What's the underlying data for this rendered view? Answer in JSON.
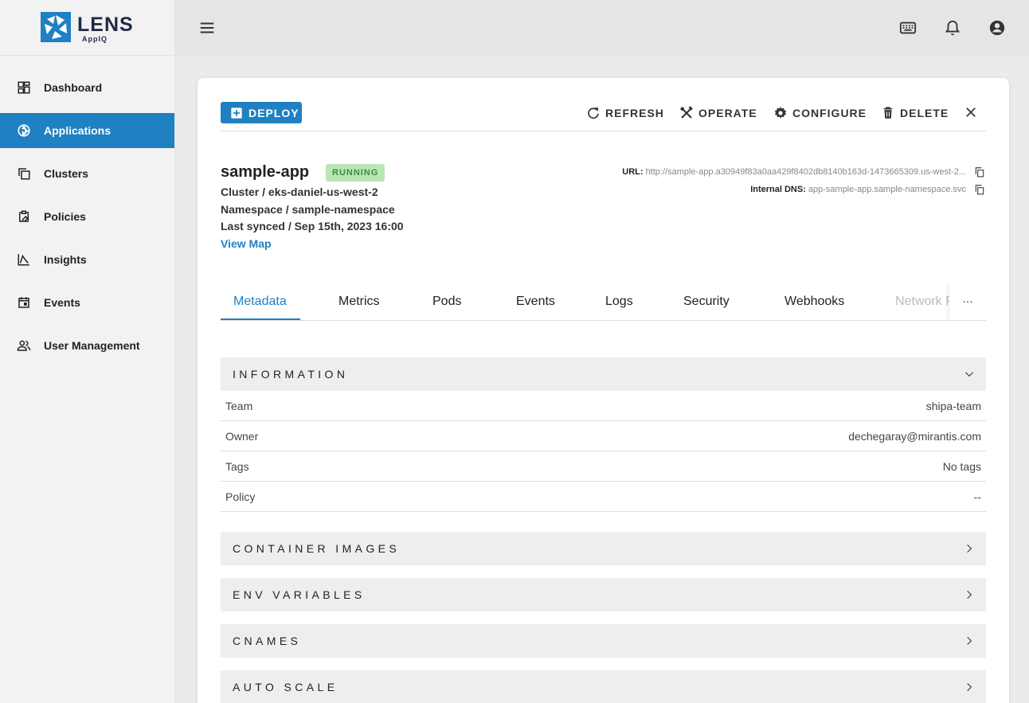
{
  "brand": {
    "name": "LENS",
    "sub": "AppIQ"
  },
  "sidebar": {
    "items": [
      {
        "label": "Dashboard",
        "icon": "dashboard-icon"
      },
      {
        "label": "Applications",
        "icon": "applications-icon",
        "active": true
      },
      {
        "label": "Clusters",
        "icon": "clusters-icon"
      },
      {
        "label": "Policies",
        "icon": "policies-icon"
      },
      {
        "label": "Insights",
        "icon": "insights-icon"
      },
      {
        "label": "Events",
        "icon": "events-icon"
      },
      {
        "label": "User Management",
        "icon": "users-icon"
      }
    ]
  },
  "header": {
    "icons": [
      "menu-icon",
      "keyboard-icon",
      "bell-icon",
      "account-icon"
    ]
  },
  "toolbar": {
    "deploy": "DEPLOY",
    "refresh": "REFRESH",
    "operate": "OPERATE",
    "configure": "CONFIGURE",
    "delete": "DELETE"
  },
  "app": {
    "name": "sample-app",
    "status": "RUNNING",
    "cluster": "Cluster / eks-daniel-us-west-2",
    "namespace": "Namespace / sample-namespace",
    "last_synced": "Last synced / Sep 15th, 2023 16:00",
    "view_map": "View Map",
    "url_label": "URL:",
    "url_value": "http://sample-app.a30949f83a0aa429f8402db8140b163d-1473665309.us-west-2...",
    "dns_label": "Internal DNS:",
    "dns_value": "app-sample-app.sample-namespace.svc"
  },
  "tabs": [
    "Metadata",
    "Metrics",
    "Pods",
    "Events",
    "Logs",
    "Security",
    "Webhooks",
    "Network P"
  ],
  "tabs_more": "...",
  "sections": {
    "information": "INFORMATION",
    "container_images": "CONTAINER IMAGES",
    "env_variables": "ENV VARIABLES",
    "cnames": "CNAMES",
    "auto_scale": "AUTO SCALE"
  },
  "info_rows": [
    {
      "key": "Team",
      "value": "shipa-team"
    },
    {
      "key": "Owner",
      "value": "dechegaray@mirantis.com"
    },
    {
      "key": "Tags",
      "value": "No tags"
    },
    {
      "key": "Policy",
      "value": "--"
    }
  ],
  "colors": {
    "accent": "#1f80c2",
    "running_bg": "#b9e6b6",
    "running_fg": "#3b8d3a"
  }
}
